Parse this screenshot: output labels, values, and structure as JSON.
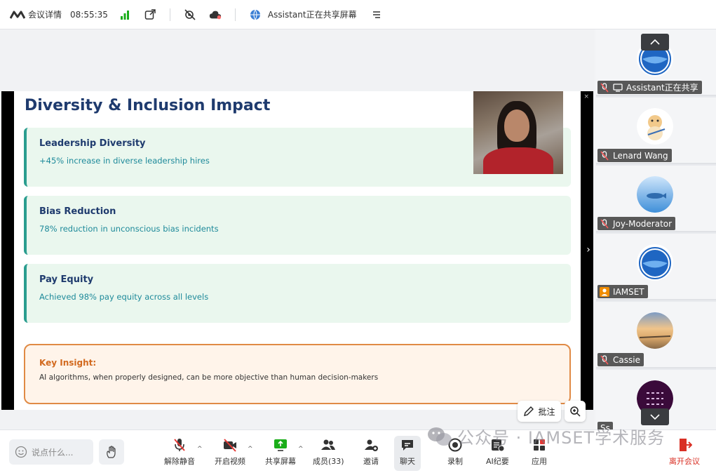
{
  "topbar": {
    "meeting_info": "会议详情",
    "time": "08:55:35",
    "sharing_status": "Assistant正在共享屏幕"
  },
  "slide": {
    "title": "Diversity & Inclusion Impact",
    "cards": [
      {
        "title": "Leadership Diversity",
        "desc": "+45% increase in diverse leadership hires"
      },
      {
        "title": "Bias Reduction",
        "desc": "78% reduction in unconscious bias incidents"
      },
      {
        "title": "Pay Equity",
        "desc": "Achieved 98% pay equity across all levels"
      }
    ],
    "insight": {
      "title": "Key Insight:",
      "desc": "AI algorithms, when properly designed, can be more objective than human decision-makers"
    }
  },
  "stage": {
    "annotate_label": "批注"
  },
  "participants": [
    {
      "name": "Assistant正在共享",
      "avatar": "iamset-logo",
      "status_icon": "mic-muted-icon"
    },
    {
      "name": "Lenard Wang",
      "avatar": "hamster-drawing",
      "status_icon": "mic-muted-icon"
    },
    {
      "name": "Joy-Moderator",
      "avatar": "fish-sky",
      "status_icon": "mic-muted-icon"
    },
    {
      "name": "IAMSET",
      "avatar": "iamset-logo",
      "status_icon": "user-icon"
    },
    {
      "name": "Cassie",
      "avatar": "sunset-landscape",
      "status_icon": "mic-muted-icon"
    },
    {
      "name": "Ss",
      "avatar": "calligraphy-purple",
      "status_icon": ""
    }
  ],
  "bottombar": {
    "chat_placeholder": "说点什么...",
    "unmute": "解除静音",
    "start_video": "开启视频",
    "share_screen": "共享屏幕",
    "members": "成员(33)",
    "invite": "邀请",
    "chat": "聊天",
    "record": "录制",
    "ai_minutes": "AI纪要",
    "apps": "应用",
    "leave": "离开会议"
  },
  "watermark": "公众号 · IAMSET学术服务",
  "colors": {
    "slide_title": "#1f3b6e",
    "card_bg": "#eaf7ee",
    "card_accent": "#2a9d8f",
    "insight_border": "#e08a45",
    "leave_red": "#d93025"
  }
}
